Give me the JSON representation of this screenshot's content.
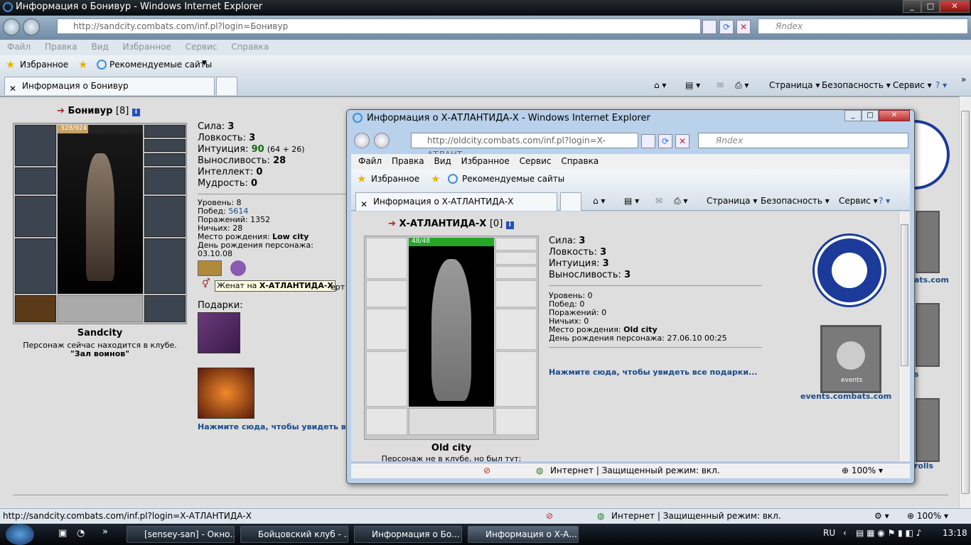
{
  "window": {
    "title": "Информация о Бонивур - Windows Internet Explorer",
    "address": "http://sandcity.combats.com/inf.pl?login=Бонивур",
    "search_placeholder": "Яndex"
  },
  "menu": [
    "Файл",
    "Правка",
    "Вид",
    "Избранное",
    "Сервис",
    "Справка"
  ],
  "favorites": {
    "label": "Избранное",
    "suggested": "Рекомендуемые сайты"
  },
  "tab": {
    "label": "Информация о Бонивур"
  },
  "commands": {
    "page": "Страница",
    "security": "Безопасность",
    "tools": "Сервис"
  },
  "character": {
    "name": "Бонивур",
    "level_tag": "[8]",
    "hp": "328/924",
    "city": "Sandcity",
    "location_text": "Персонаж сейчас находится в клубе.",
    "location_room": "\"Зал воинов\"",
    "stats": [
      {
        "label": "Сила:",
        "value": "3",
        "extra": ""
      },
      {
        "label": "Ловкость:",
        "value": "3",
        "extra": ""
      },
      {
        "label": "Интуиция:",
        "value": "90",
        "extra": "(64 + 26)"
      },
      {
        "label": "Выносливость:",
        "value": "28",
        "extra": ""
      },
      {
        "label": "Интеллект:",
        "value": "0",
        "extra": ""
      },
      {
        "label": "Мудрость:",
        "value": "0",
        "extra": ""
      }
    ],
    "info": [
      {
        "label": "Уровень:",
        "value": "8"
      },
      {
        "label": "Побед:",
        "value": "5614"
      },
      {
        "label": "Поражений:",
        "value": "1352"
      },
      {
        "label": "Ничьих:",
        "value": "28"
      },
      {
        "label": "Место рождения:",
        "value": "Low city"
      },
      {
        "label": "День рождения персонажа:",
        "value": "03.10.08"
      }
    ],
    "married_prefix": "Женат на",
    "married_to": "Х-АТЛАНТИДА-Х",
    "married_tail": "ерт",
    "gifts_label": "Подарки:",
    "gifts_link": "Нажмите сюда, чтобы увидеть все п"
  },
  "right_links": {
    "a": "ats.com",
    "b": "s",
    "c": "rolls"
  },
  "popup": {
    "title": "Информация о Х-АТЛАНТИДА-Х - Windows Internet Explorer",
    "address": "http://oldcity.combats.com/inf.pl?login=Х-АТЛАНТ",
    "search_placeholder": "Яndex",
    "menu": [
      "Файл",
      "Правка",
      "Вид",
      "Избранное",
      "Сервис",
      "Справка"
    ],
    "tab": "Информация о Х-АТЛАНТИДА-Х",
    "name": "Х-АТЛАНТИДА-Х",
    "level_tag": "[0]",
    "hp": "48/48",
    "city": "Old city",
    "location_text": "Персонаж не в клубе, но был тут:",
    "stats": [
      {
        "label": "Сила:",
        "value": "3"
      },
      {
        "label": "Ловкость:",
        "value": "3"
      },
      {
        "label": "Интуиция:",
        "value": "3"
      },
      {
        "label": "Выносливость:",
        "value": "3"
      }
    ],
    "info": [
      {
        "label": "Уровень:",
        "value": "0"
      },
      {
        "label": "Побед:",
        "value": "0"
      },
      {
        "label": "Поражений:",
        "value": "0"
      },
      {
        "label": "Ничьих:",
        "value": "0"
      },
      {
        "label": "Место рождения:",
        "value": "Old city"
      },
      {
        "label": "День рождения персонажа:",
        "value": "27.06.10 00:25"
      }
    ],
    "gifts_link": "Нажмите сюда, чтобы увидеть все подарки...",
    "events_label": "events",
    "events_link": "events.combats.com",
    "status": "Интернет | Защищенный режим: вкл.",
    "zoom": "100%"
  },
  "status": {
    "url": "http://sandcity.combats.com/inf.pl?login=Х-АТЛАНТИДА-Х",
    "zone": "Интернет | Защищенный режим: вкл.",
    "zoom": "100%"
  },
  "taskbar": {
    "items": [
      "[sensey-san] - Окно...",
      "Бойцовский клуб - ...",
      "Информация о Бо...",
      "Информация о Х-А..."
    ],
    "lang": "RU",
    "time": "13:18"
  },
  "colors": {
    "hp_bar": "#27a52a",
    "link": "#1a4a8a",
    "emblem": "#1b3a9a"
  }
}
